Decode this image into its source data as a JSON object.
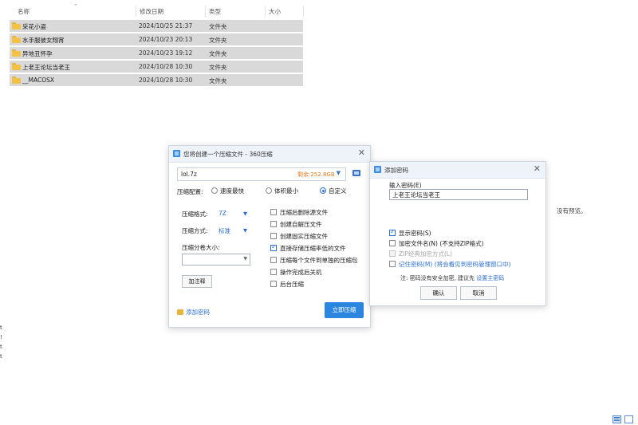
{
  "explorer": {
    "columns": {
      "name": "名称",
      "date": "修改日期",
      "type": "类型",
      "size": "大小"
    },
    "sort_arrow": "⌃",
    "rows": [
      {
        "name": "采花小盗",
        "date": "2024/10/25 21:37",
        "type": "文件夹"
      },
      {
        "name": "水手服彼女翔宵",
        "date": "2024/10/23 20:13",
        "type": "文件夹"
      },
      {
        "name": "异地丑怀孕",
        "date": "2024/10/23 19:12",
        "type": "文件夹"
      },
      {
        "name": "上老王论坛当老王",
        "date": "2024/10/28 10:30",
        "type": "文件夹"
      },
      {
        "name": "__MACOSX",
        "date": "2024/10/28 10:30",
        "type": "文件夹"
      }
    ],
    "no_preview": "没有预览。",
    "left_marks": [
      "t",
      "!",
      "t",
      "t"
    ]
  },
  "compress_dialog": {
    "title": "您将创建一个压缩文件 - 360压缩",
    "close": "✕",
    "filename": "lol.7z",
    "free_space": "剩余:252.8GB",
    "config_label": "压缩配置:",
    "presets": [
      {
        "label": "速度最快",
        "selected": false
      },
      {
        "label": "体积最小",
        "selected": false
      },
      {
        "label": "自定义",
        "selected": true
      }
    ],
    "format_label": "压缩格式:",
    "format_value": "7Z",
    "method_label": "压缩方式:",
    "method_value": "标准",
    "volume_label": "压缩分卷大小:",
    "comment_button": "加注释",
    "options": [
      {
        "label": "压缩后删除源文件",
        "checked": false
      },
      {
        "label": "创建自解压文件",
        "checked": false
      },
      {
        "label": "创建固实压缩文件",
        "checked": false
      },
      {
        "label": "直接存储压缩率低的文件",
        "checked": true
      },
      {
        "label": "压缩每个文件到单独的压缩包",
        "checked": false
      },
      {
        "label": "操作完成后关机",
        "checked": false
      },
      {
        "label": "后台压缩",
        "checked": false
      }
    ],
    "add_password": "添加密码",
    "start_button": "立即压缩"
  },
  "password_dialog": {
    "title": "添加密码",
    "close": "✕",
    "input_label": "输入密码(E)",
    "password_value": "上老王论坛当老王",
    "options": [
      {
        "label": "显示密码(S)",
        "checked": true,
        "state": "normal"
      },
      {
        "label": "加密文件名(N) (不支持ZIP格式)",
        "checked": false,
        "state": "normal"
      },
      {
        "label": "ZIP经典加密方式(L)",
        "checked": false,
        "state": "disabled"
      },
      {
        "label": "记住密码(M) (将会看见到密码管理窗口中)",
        "checked": false,
        "state": "link"
      }
    ],
    "note": "注: 密码没有安全加密, 建议先 ",
    "note_link": "设置主密码",
    "ok_button": "确认",
    "cancel_button": "取消"
  },
  "colors": {
    "accent": "#2a86de",
    "folder": "#f3c244",
    "row_highlight": "#d9d9d9"
  }
}
